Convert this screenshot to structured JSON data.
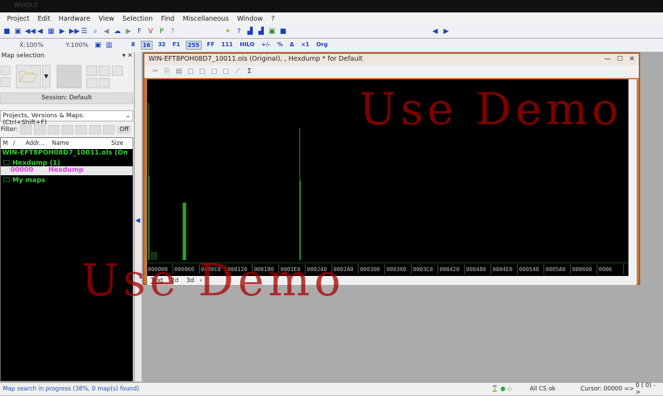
{
  "app": {
    "title": "WinOLS"
  },
  "menu": [
    "Project",
    "Edit",
    "Hardware",
    "View",
    "Selection",
    "Find",
    "Miscellaneous",
    "Window",
    "?"
  ],
  "toolbar2": {
    "x_zoom": "X:100%",
    "y_zoom": "Y:100%",
    "buttons": [
      "8",
      "16",
      "32",
      "F1",
      "255",
      "FF",
      "111",
      "HILO",
      "+/-",
      "%",
      "Δ",
      "×1",
      "Org"
    ]
  },
  "left_panel": {
    "title": "Map selection",
    "session": "Session: Default",
    "combo": "Projects, Versions & Maps:  (Ctrl+Shift+F)",
    "filter_label": "Filter:",
    "filter_value": "Off",
    "columns": [
      "M",
      "/",
      "Addr...",
      "Name",
      "Size"
    ],
    "tree": [
      {
        "text": "WIN-EFT8POH08D7_10011.ols (On",
        "color": "#2fd02f"
      },
      {
        "text": "Hexdump (1)",
        "color": "#2fd02f"
      },
      {
        "addr": "00000",
        "name": "Hexdump",
        "color": "#e040e0"
      },
      {
        "text": "My maps",
        "color": "#2fd02f"
      }
    ]
  },
  "child": {
    "title": "WIN-EFT8POH08D7_10011.ols (Original), , Hexdump * for Default",
    "axis_labels": [
      "000000",
      "000060",
      "0000C0",
      "000120",
      "000180",
      "0001E0",
      "000240",
      "0002A0",
      "000300",
      "000360",
      "0003C0",
      "000420",
      "000480",
      "0004E0",
      "000540",
      "0005A0",
      "000600",
      "0006"
    ],
    "tabs": [
      "Text",
      "2d",
      "3d"
    ],
    "graph_color": "#2fa02f"
  },
  "watermark": "Use Demo",
  "status": {
    "left": "Map search in progress (38%, 0 map(s) found)",
    "cs": "All CS ok",
    "cursor": "Cursor: 00000 =>",
    "value": "0 (   0) ->"
  }
}
